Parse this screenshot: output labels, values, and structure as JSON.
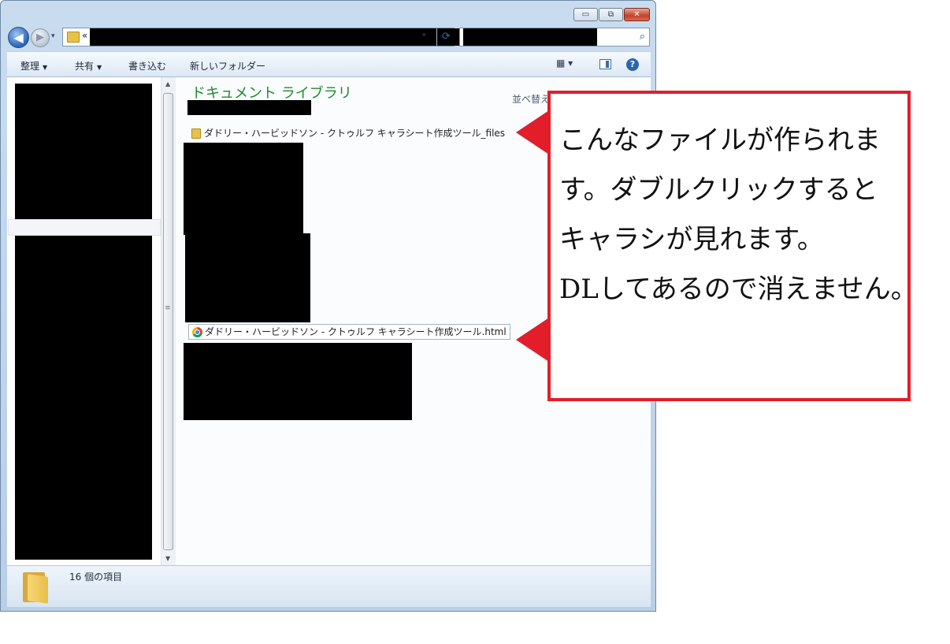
{
  "window": {
    "controls": {
      "minimize": "▭",
      "maximize": "⧉",
      "close": "✕"
    },
    "nav": {
      "back": "◀",
      "forward": "▶",
      "history_dropdown": "▾"
    },
    "address": {
      "chevron": "«",
      "dropdown": "▾",
      "refresh": "⟳"
    },
    "search": {
      "icon": "⌕"
    },
    "toolbar": {
      "organize_label": "整理",
      "share_label": "共有",
      "burn_label": "書き込む",
      "new_folder_label": "新しいフォルダー",
      "arrow": "▼",
      "views_icon": "▦ ▾",
      "help_icon": "?"
    },
    "library": {
      "title": "ドキュメント ライブラリ",
      "sort_label": "並べ替え"
    },
    "files": [
      {
        "name": "ダドリー・ハービッドソン - クトゥルフ キャラシート作成ツール_files",
        "type": "folder"
      },
      {
        "name": "ダドリー・ハービッドソン - クトゥルフ キャラシート作成ツール.html",
        "type": "chrome-html"
      }
    ],
    "status": {
      "item_count": "16 個の項目"
    }
  },
  "annotation": {
    "accent_color": "#e21e2a",
    "lines": [
      "こんなファイルが作られま",
      "す。ダブルクリックすると",
      "キャラシが見れます。",
      "DLしてあるので消えません。"
    ]
  }
}
